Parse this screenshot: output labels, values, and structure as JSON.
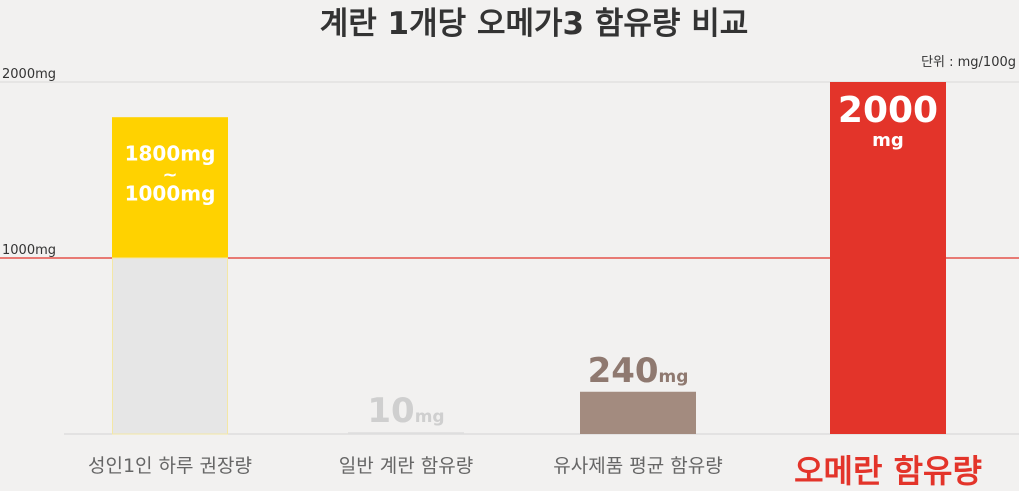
{
  "chart_data": {
    "type": "bar",
    "title": "계란 1개당 오메가3 함유량 비교",
    "unit_note": "단위 : mg/100g",
    "ylim": [
      0,
      2000
    ],
    "yticks": [
      {
        "value": 2000,
        "label": "2000mg"
      },
      {
        "value": 1000,
        "label": "1000mg"
      }
    ],
    "reference_line": 1000,
    "grid": true,
    "categories": [
      "성인1인 하루 권장량",
      "일반 계란 함유량",
      "유사제품 평균 함유량",
      "오메란 함유량"
    ],
    "bars": [
      {
        "category": "성인1인 하루 권장량",
        "range": [
          1000,
          1800
        ],
        "label_top": "1800mg",
        "label_sep": "~",
        "label_bottom": "1000mg",
        "color_base": "#e6e6e6",
        "color_range": "#ffd200",
        "label_color": "#ffffff"
      },
      {
        "category": "일반 계란 함유량",
        "value": 10,
        "label_num": "10",
        "label_unit": "mg",
        "color": "#dedede",
        "label_color": "#cfcfcf"
      },
      {
        "category": "유사제품 평균 함유량",
        "value": 240,
        "label_num": "240",
        "label_unit": "mg",
        "color": "#a38b7f",
        "label_color": "#8f7970"
      },
      {
        "category": "오메란 함유량",
        "value": 2000,
        "label_num": "2000",
        "label_unit": "mg",
        "color": "#e3342a",
        "label_color": "#ffffff",
        "highlight": true
      }
    ],
    "colors": {
      "title": "#333333",
      "axis_text": "#333333",
      "grid": "#d9d9d9",
      "reference_line": "#e3342a",
      "category_text": "#666666",
      "highlight_category_text": "#e3342a"
    }
  }
}
